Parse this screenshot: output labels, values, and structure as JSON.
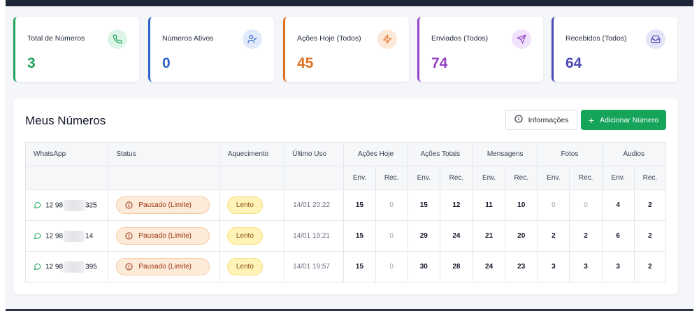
{
  "stats": [
    {
      "label": "Total de Números",
      "value": "3",
      "color": "#22a35a",
      "icon": "phone-icon",
      "icon_bg": "#dcf5e6"
    },
    {
      "label": "Números Ativos",
      "value": "0",
      "color": "#2f63c9",
      "icon": "user-check-icon",
      "icon_bg": "#e0eafb"
    },
    {
      "label": "Ações Hoje (Todos)",
      "value": "45",
      "color": "#e07020",
      "icon": "bolt-icon",
      "icon_bg": "#fde7d6"
    },
    {
      "label": "Enviados (Todos)",
      "value": "74",
      "color": "#9442c8",
      "icon": "send-icon",
      "icon_bg": "#f0e2fb"
    },
    {
      "label": "Recebidos (Todos)",
      "value": "64",
      "color": "#4a48b5",
      "icon": "inbox-icon",
      "icon_bg": "#e3e4f8"
    }
  ],
  "panel": {
    "title": "Meus Números",
    "info_button": "Informações",
    "add_button": "Adicionar Número"
  },
  "table": {
    "headers": {
      "whatsapp": "WhatsApp",
      "status": "Status",
      "aquecimento": "Aquecimento",
      "ultimo_uso": "Último Uso",
      "acoes_hoje": "Ações Hoje",
      "acoes_totais": "Ações Totais",
      "mensagens": "Mensagens",
      "fotos": "Fotos",
      "audios": "Áudios"
    },
    "sub": {
      "env": "Env.",
      "rec": "Rec."
    },
    "rows": [
      {
        "prefix": "12 98",
        "suffix": "325",
        "status": "Pausado (Limite)",
        "speed": "Lento",
        "last": "14/01 20:22",
        "hoje_env": "15",
        "hoje_rec": "0",
        "tot_env": "15",
        "tot_rec": "12",
        "msg_env": "11",
        "msg_rec": "10",
        "foto_env": "0",
        "foto_rec": "0",
        "aud_env": "4",
        "aud_rec": "2"
      },
      {
        "prefix": "12 98",
        "suffix": "14",
        "status": "Pausado (Limite)",
        "speed": "Lento",
        "last": "14/01 19:21",
        "hoje_env": "15",
        "hoje_rec": "0",
        "tot_env": "29",
        "tot_rec": "24",
        "msg_env": "21",
        "msg_rec": "20",
        "foto_env": "2",
        "foto_rec": "2",
        "aud_env": "6",
        "aud_rec": "2"
      },
      {
        "prefix": "12 98",
        "suffix": "395",
        "status": "Pausado (Limite)",
        "speed": "Lento",
        "last": "14/01 19:57",
        "hoje_env": "15",
        "hoje_rec": "0",
        "tot_env": "30",
        "tot_rec": "28",
        "msg_env": "24",
        "msg_rec": "23",
        "foto_env": "3",
        "foto_rec": "3",
        "aud_env": "3",
        "aud_rec": "2"
      }
    ]
  }
}
